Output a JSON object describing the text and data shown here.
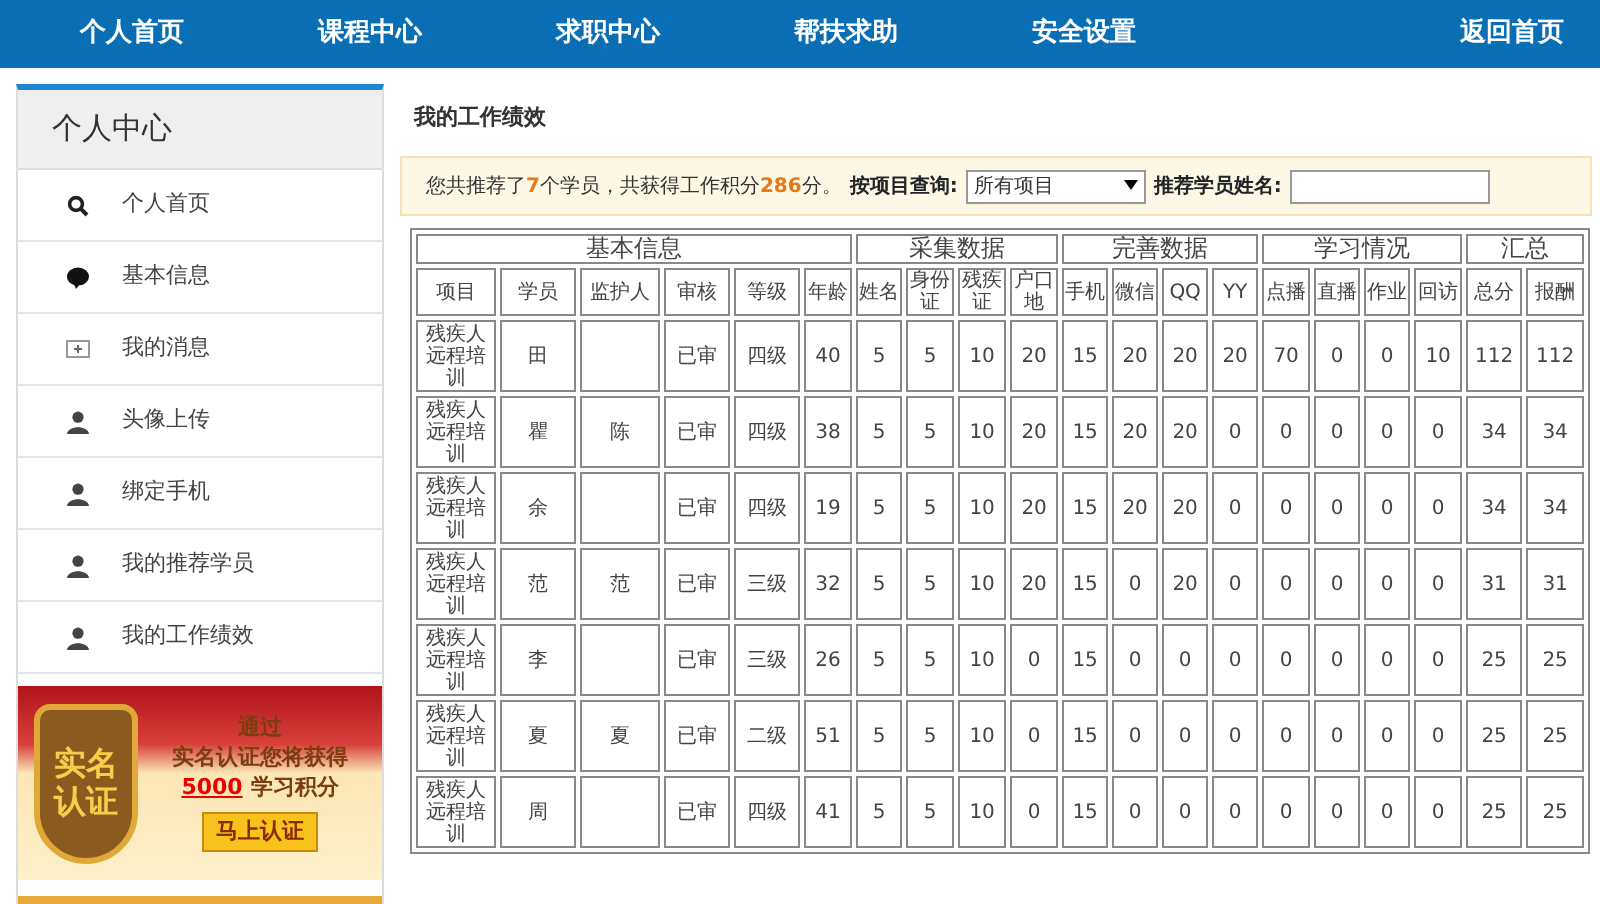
{
  "top_nav": {
    "items": [
      {
        "label": "个人首页"
      },
      {
        "label": "课程中心"
      },
      {
        "label": "求职中心"
      },
      {
        "label": "帮扶求助"
      },
      {
        "label": "安全设置"
      }
    ],
    "home_link": "返回首页"
  },
  "sidebar": {
    "title": "个人中心",
    "items": [
      {
        "label": "个人首页",
        "kind": "search"
      },
      {
        "label": "基本信息",
        "kind": "chat"
      },
      {
        "label": "我的消息",
        "kind": "message"
      },
      {
        "label": "头像上传",
        "kind": "profile"
      },
      {
        "label": "绑定手机",
        "kind": "profile"
      },
      {
        "label": "我的推荐学员",
        "kind": "profile"
      },
      {
        "label": "我的工作绩效",
        "kind": "profile"
      }
    ],
    "banner": {
      "badge_line_1": "实名",
      "badge_line_2": "认证",
      "line_1": "通过",
      "line_2": "实名认证您将获得",
      "points": "5000",
      "points_suffix": "学习积分",
      "button": "马上认证"
    }
  },
  "page_title": "我的工作绩效",
  "summary": {
    "text": "您共推荐了**7**个学员，共获得工作积分**286**分。",
    "project_label": "按项目查询:",
    "project_value": "所有项目",
    "name_label": "推荐学员姓名:"
  },
  "table": {
    "groups": [
      {
        "label": "基本信息"
      },
      {
        "label": "采集数据"
      },
      {
        "label": "完善数据"
      },
      {
        "label": "学习情况"
      },
      {
        "label": "汇总"
      }
    ],
    "columns": [
      "项目",
      "学员",
      "监护人",
      "审核",
      "等级",
      "年龄",
      "姓名",
      "身份证",
      "残疾证",
      "户口地",
      "手机",
      "微信",
      "QQ",
      "YY",
      "点播",
      "直播",
      "作业",
      "回访",
      "总分",
      "报酬"
    ],
    "rows": [
      [
        "残疾人远程培训",
        "田",
        null,
        "已审",
        "四级",
        "40",
        "5",
        "5",
        "10",
        "20",
        "15",
        "20",
        "20",
        "20",
        "70",
        "0",
        "0",
        "10",
        "112",
        "112"
      ],
      [
        "残疾人远程培训",
        "瞿",
        "陈",
        "已审",
        "四级",
        "38",
        "5",
        "5",
        "10",
        "20",
        "15",
        "20",
        "20",
        "0",
        "0",
        "0",
        "0",
        "0",
        "34",
        "34"
      ],
      [
        "残疾人远程培训",
        "余",
        null,
        "已审",
        "四级",
        "19",
        "5",
        "5",
        "10",
        "20",
        "15",
        "20",
        "20",
        "0",
        "0",
        "0",
        "0",
        "0",
        "34",
        "34"
      ],
      [
        "残疾人远程培训",
        "范",
        "范",
        "已审",
        "三级",
        "32",
        "5",
        "5",
        "10",
        "20",
        "15",
        "0",
        "20",
        "0",
        "0",
        "0",
        "0",
        "0",
        "31",
        "31"
      ],
      [
        "残疾人远程培训",
        "李",
        null,
        "已审",
        "三级",
        "26",
        "5",
        "5",
        "10",
        "0",
        "15",
        "0",
        "0",
        "0",
        "0",
        "0",
        "0",
        "0",
        "25",
        "25"
      ],
      [
        "残疾人远程培训",
        "夏",
        "夏",
        "已审",
        "二级",
        "51",
        "5",
        "5",
        "10",
        "0",
        "15",
        "0",
        "0",
        "0",
        "0",
        "0",
        "0",
        "0",
        "25",
        "25"
      ],
      [
        "残疾人远程培训",
        "周",
        null,
        "已审",
        "四级",
        "41",
        "5",
        "5",
        "10",
        "0",
        "15",
        "0",
        "0",
        "0",
        "0",
        "0",
        "0",
        "0",
        "25",
        "25"
      ]
    ]
  }
}
